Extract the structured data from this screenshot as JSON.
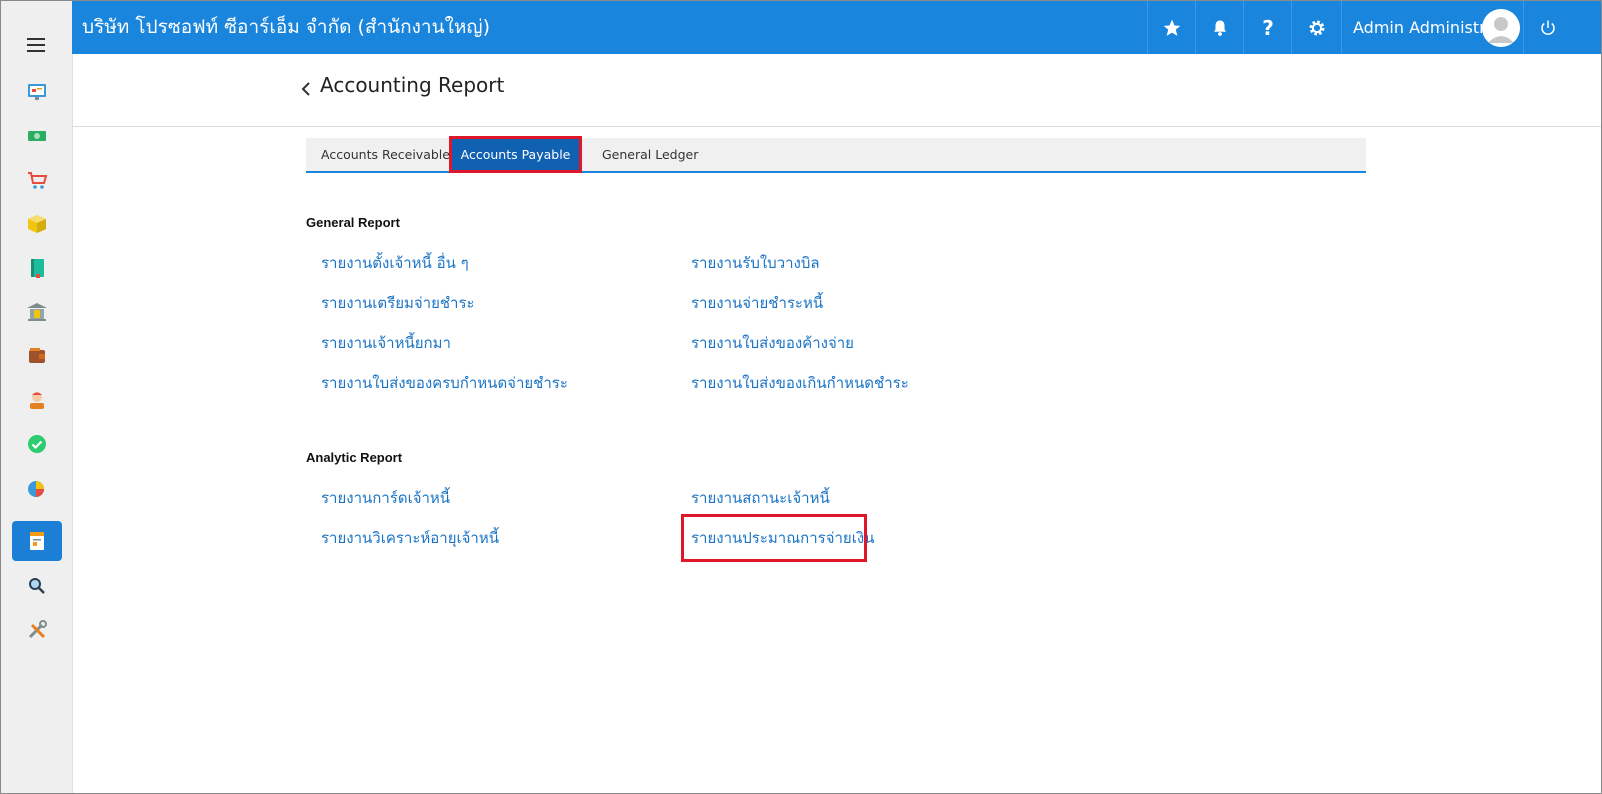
{
  "header": {
    "company_name": "บริษัท โปรซอฟท์ ซีอาร์เอ็ม จำกัด (สำนักงานใหญ่)",
    "user_name": "Admin Administr...",
    "brand_color": "#1a85dc"
  },
  "page": {
    "title": "Accounting Report"
  },
  "tabs": [
    {
      "label": "Accounts Receivable"
    },
    {
      "label": "Accounts Payable",
      "active": true
    },
    {
      "label": "General Ledger"
    }
  ],
  "sections": {
    "general": {
      "title": "General Report",
      "links": [
        "รายงานตั้งเจ้าหนี้ อื่น ๆ",
        "รายงานรับใบวางบิล",
        "รายงานเตรียมจ่ายชำระ",
        "รายงานจ่ายชำระหนี้",
        "รายงานเจ้าหนี้ยกมา",
        "รายงานใบส่งของค้างจ่าย",
        "รายงานใบส่งของครบกำหนดจ่ายชำระ",
        "รายงานใบส่งของเกินกำหนดชำระ"
      ]
    },
    "analytic": {
      "title": "Analytic Report",
      "links": [
        "รายงานการ์ดเจ้าหนี้",
        "รายงานสถานะเจ้าหนี้",
        "รายงานวิเคราะห์อายุเจ้าหนี้",
        "รายงานประมาณการจ่ายเงิน"
      ]
    }
  },
  "sidebar_icons": [
    "dashboard-icon",
    "money-icon",
    "cart-icon",
    "box-icon",
    "book-icon",
    "bank-icon",
    "wallet-icon",
    "customer-icon",
    "check-icon",
    "pie-chart-icon",
    "report-icon",
    "search-icon",
    "tools-icon"
  ],
  "highlight_color": "#e0162b"
}
